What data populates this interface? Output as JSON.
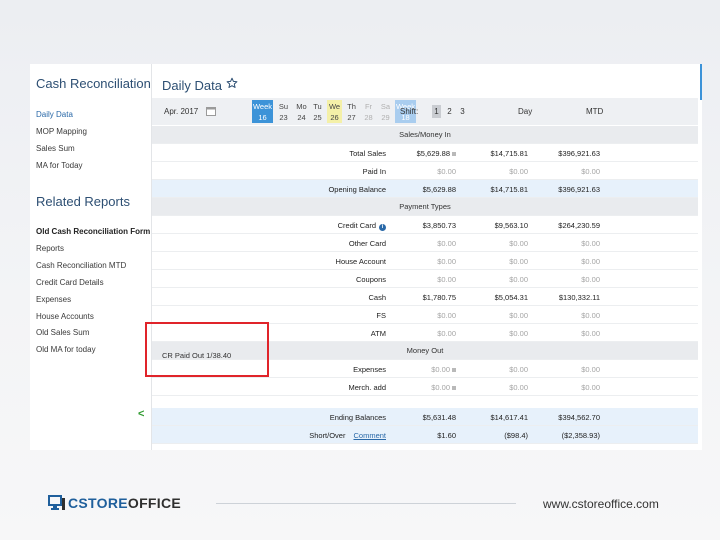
{
  "sidebar": {
    "title": "Cash Reconciliation",
    "links": [
      "Daily Data",
      "MOP Mapping",
      "Sales Sum",
      "MA for Today"
    ],
    "related_title": "Related Reports",
    "related": [
      "Old Cash Reconciliation Form",
      "Reports",
      "Cash Reconciliation MTD",
      "Credit Card Details",
      "Expenses",
      "House Accounts",
      "Old Sales Sum",
      "Old MA for today"
    ],
    "collapse_glyph": "<"
  },
  "header": {
    "title": "Daily Data",
    "star_icon": "star-outline-icon"
  },
  "toolbar": {
    "month": "Apr. 2017",
    "days": [
      {
        "top": "Week",
        "num": "16",
        "kind": "week"
      },
      {
        "top": "Su",
        "num": "23",
        "kind": "day"
      },
      {
        "top": "Mo",
        "num": "24",
        "kind": "day"
      },
      {
        "top": "Tu",
        "num": "25",
        "kind": "day"
      },
      {
        "top": "We",
        "num": "26",
        "kind": "today"
      },
      {
        "top": "Th",
        "num": "27",
        "kind": "day"
      },
      {
        "top": "Fr",
        "num": "28",
        "kind": "future"
      },
      {
        "top": "Sa",
        "num": "29",
        "kind": "future"
      },
      {
        "top": "Week",
        "num": "18",
        "kind": "week-faded"
      }
    ],
    "shift_label": "Shift:",
    "shifts": [
      "1",
      "2",
      "3"
    ],
    "col_day": "Day",
    "col_mtd": "MTD"
  },
  "table": {
    "sales_header": "Sales/Money In",
    "sales": [
      {
        "label": "Total Sales",
        "v1": "$5,629.88",
        "v2": "$14,715.81",
        "v3": "$396,921.63",
        "lock": true
      },
      {
        "label": "Paid In",
        "v1": "$0.00",
        "v2": "$0.00",
        "v3": "$0.00",
        "grey": true
      },
      {
        "label": "Opening Balance",
        "v1": "$5,629.88",
        "v2": "$14,715.81",
        "v3": "$396,921.63",
        "highlight": true
      }
    ],
    "payment_header": "Payment Types",
    "payments": [
      {
        "label": "Credit Card",
        "v1": "$3,850.73",
        "v2": "$9,563.10",
        "v3": "$264,230.59",
        "info": true
      },
      {
        "label": "Other Card",
        "v1": "$0.00",
        "v2": "$0.00",
        "v3": "$0.00",
        "grey": true
      },
      {
        "label": "House Account",
        "v1": "$0.00",
        "v2": "$0.00",
        "v3": "$0.00",
        "grey": true
      },
      {
        "label": "Coupons",
        "v1": "$0.00",
        "v2": "$0.00",
        "v3": "$0.00",
        "grey": true
      },
      {
        "label": "Cash",
        "v1": "$1,780.75",
        "v2": "$5,054.31",
        "v3": "$130,332.11"
      },
      {
        "label": "FS",
        "v1": "$0.00",
        "v2": "$0.00",
        "v3": "$0.00",
        "grey": true
      },
      {
        "label": "ATM",
        "v1": "$0.00",
        "v2": "$0.00",
        "v3": "$0.00",
        "grey": true
      }
    ],
    "cr_note": "CR Paid Out 1/38.40",
    "money_out_header": "Money Out",
    "money_out": [
      {
        "label": "Expenses",
        "v1": "$0.00",
        "v2": "$0.00",
        "v3": "$0.00",
        "grey": true,
        "lock": true
      },
      {
        "label": "Merch. add",
        "v1": "$0.00",
        "v2": "$0.00",
        "v3": "$0.00",
        "grey": true,
        "lock": true
      }
    ],
    "ending": {
      "label": "Ending Balances",
      "v1": "$5,631.48",
      "v2": "$14,617.41",
      "v3": "$394,562.70"
    },
    "short_over": {
      "label": "Short/Over",
      "link": "Comment",
      "v1": "$1.60",
      "v2": "($98.4)",
      "v3": "($2,358.93)"
    }
  },
  "footer": {
    "logo_part1": "CSTORE",
    "logo_part2": "OFFICE",
    "url": "www.cstoreoffice.com"
  },
  "colors": {
    "accent": "#3c93d8",
    "title": "#2d4f73",
    "highlight_box": "#e0242a",
    "today": "#f4f0a8"
  }
}
